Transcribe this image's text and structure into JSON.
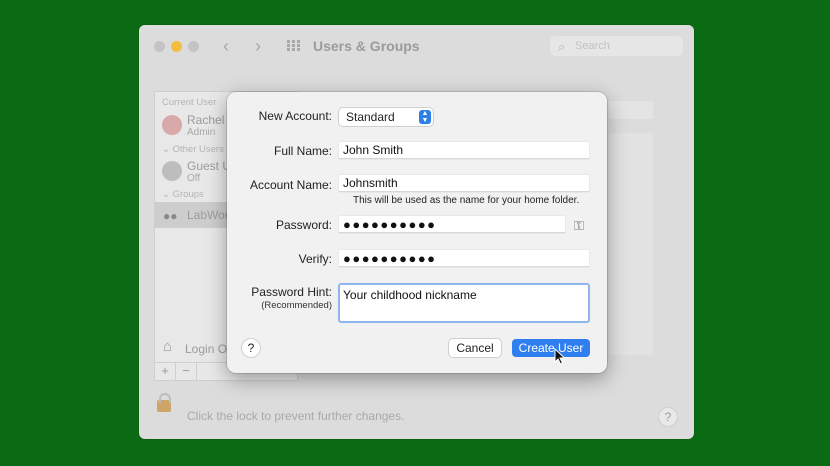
{
  "window": {
    "title": "Users & Groups",
    "search_placeholder": "Search"
  },
  "sidebar": {
    "current_user_header": "Current User",
    "current_user": {
      "name": "Rachel N",
      "role": "Admin"
    },
    "other_users_header": "Other Users",
    "other_user": {
      "name": "Guest U",
      "status": "Off"
    },
    "groups_header": "Groups",
    "group": {
      "name": "LabWork"
    },
    "login_options": "Login Op",
    "add_label": "+",
    "remove_label": "−"
  },
  "footer": {
    "lock_text": "Click the lock to prevent further changes.",
    "help_label": "?"
  },
  "dialog": {
    "new_account_label": "New Account:",
    "new_account_value": "Standard",
    "full_name_label": "Full Name:",
    "full_name_value": "John Smith",
    "account_name_label": "Account Name:",
    "account_name_value": "Johnsmith",
    "account_name_hint": "This will be used as the name for your home folder.",
    "password_label": "Password:",
    "password_value": "●●●●●●●●●●",
    "verify_label": "Verify:",
    "verify_value": "●●●●●●●●●●",
    "password_hint_label": "Password Hint:",
    "password_hint_sublabel": "(Recommended)",
    "password_hint_value": "Your childhood nickname",
    "help_label": "?",
    "cancel_label": "Cancel",
    "create_label": "Create User"
  },
  "colors": {
    "desktop_background": "#0b6a14",
    "accent": "#2f7ff0",
    "focus_ring": "#8db6ef"
  }
}
